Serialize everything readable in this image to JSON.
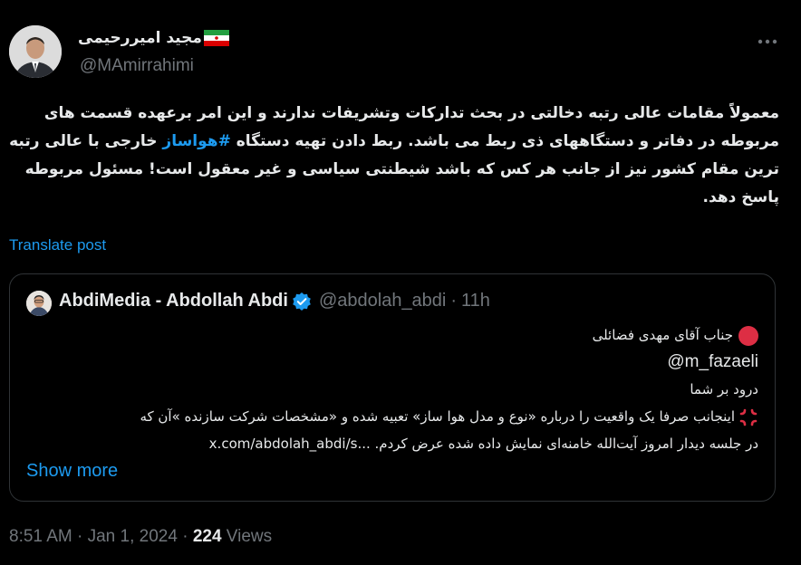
{
  "author": {
    "name": "مجید امیررحیمی",
    "handle": "@MAmirrahimi",
    "flag_icon": "iran-flag-icon"
  },
  "more_icon": "more-horizontal-icon",
  "tweet": {
    "text_before_hashtag": "معمولاً مقامات عالی رتبه دخالتی در بحث تدارکات وتشریفات ندارند و این امر برعهده قسمت های مربوطه در دفاتر و دستگاههای ذی ربط می باشد. ربط دادن تهیه دستگاه ",
    "hashtag": "#هواساز",
    "text_after_hashtag": " خارجی با عالی رتبه ترین مقام کشور نیز از جانب هر کس که باشد شیطنتی سیاسی و غیر معقول است! مسئول مربوطه پاسخ دهد.",
    "translate_label": "Translate post"
  },
  "quoted": {
    "name": "AbdiMedia - Abdollah Abdi",
    "handle": "@abdolah_abdi",
    "time": "11h",
    "line1": "جناب آقای مهدی فضائلی",
    "mention": "@m_fazaeli",
    "line3": "درود بر شما",
    "line4": "اینجانب صرفا یک واقعیت را درباره «نوع و مدل هوا ساز» تعبیه شده و «مشخصات شرکت سازنده »آن که",
    "line5": "در جلسه دیدار امروز آیت‌الله خامنه‌ای نمایش داده شده عرض کردم. ...x.com/abdolah_abdi/s",
    "show_more": "Show more"
  },
  "footer": {
    "time": "8:51 AM",
    "sep1": "·",
    "date": "Jan 1, 2024",
    "sep2": "·",
    "views_count": "224",
    "views_label": "Views"
  },
  "colors": {
    "background": "#000000",
    "text": "#e7e9ea",
    "muted": "#71767b",
    "accent": "#1d9bf0",
    "border": "#2f3336"
  }
}
